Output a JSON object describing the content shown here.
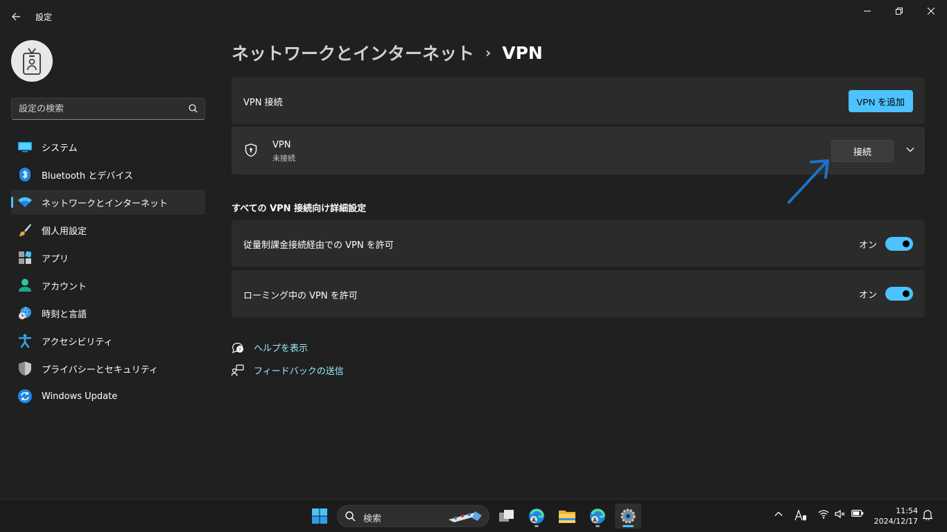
{
  "window": {
    "title": "設定"
  },
  "sidebar": {
    "search_placeholder": "設定の検索",
    "items": [
      {
        "label": "システム",
        "icon": "monitor-icon"
      },
      {
        "label": "Bluetooth とデバイス",
        "icon": "bluetooth-icon"
      },
      {
        "label": "ネットワークとインターネット",
        "icon": "wifi-icon",
        "active": true
      },
      {
        "label": "個人用設定",
        "icon": "paintbrush-icon"
      },
      {
        "label": "アプリ",
        "icon": "apps-icon"
      },
      {
        "label": "アカウント",
        "icon": "person-icon"
      },
      {
        "label": "時刻と言語",
        "icon": "globe-clock-icon"
      },
      {
        "label": "アクセシビリティ",
        "icon": "accessibility-icon"
      },
      {
        "label": "プライバシーとセキュリティ",
        "icon": "shield-icon"
      },
      {
        "label": "Windows Update",
        "icon": "update-icon"
      }
    ]
  },
  "breadcrumb": {
    "parent": "ネットワークとインターネット",
    "separator": "›",
    "current": "VPN"
  },
  "vpn_connections": {
    "label": "VPN 接続",
    "add_button": "VPN を追加"
  },
  "vpn_entry": {
    "name": "VPN",
    "status": "未接続",
    "connect_button": "接続"
  },
  "advanced": {
    "title": "すべての VPN 接続向け詳細設定",
    "settings": [
      {
        "label": "従量制課金接続経由での VPN を許可",
        "state": "オン",
        "on": true
      },
      {
        "label": "ローミング中の VPN を許可",
        "state": "オン",
        "on": true
      }
    ]
  },
  "links": {
    "help": "ヘルプを表示",
    "feedback": "フィードバックの送信"
  },
  "taskbar": {
    "search_label": "検索",
    "time": "11:54",
    "date": "2024/12/17"
  },
  "colors": {
    "accent": "#4cc2ff",
    "background": "#202020",
    "card": "#2b2b2b",
    "link": "#99ebff"
  }
}
